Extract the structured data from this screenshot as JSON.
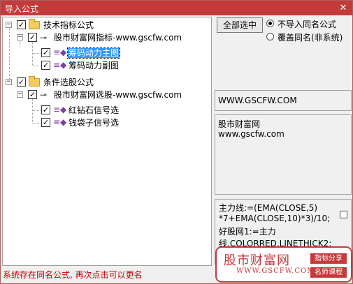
{
  "window": {
    "title": "导入公式",
    "close_glyph": "✕"
  },
  "tree": {
    "nodes": [
      {
        "label": "技术指标公式",
        "checked": true,
        "type": "folder"
      },
      {
        "label": "股市财富网指标-www.gscfw.com",
        "checked": true,
        "type": "group"
      },
      {
        "label": "筹码动力主图",
        "checked": true,
        "type": "formula",
        "selected": true
      },
      {
        "label": "筹码动力副图",
        "checked": true,
        "type": "formula"
      },
      {
        "label": "条件选股公式",
        "checked": true,
        "type": "folder"
      },
      {
        "label": "股市财富网选股-www.gscfw.com",
        "checked": true,
        "type": "group"
      },
      {
        "label": "红钻石信号选",
        "checked": true,
        "type": "formula"
      },
      {
        "label": "钱袋子信号选",
        "checked": true,
        "type": "formula"
      }
    ],
    "expander_minus": "−",
    "check_glyph": "✓"
  },
  "options": {
    "select_all": "全部选中",
    "radio_skip": "不导入同名公式",
    "radio_overwrite": "覆盖同名(非系统)",
    "selected": "skip"
  },
  "info": {
    "url": "WWW.GSCFW.COM",
    "desc_line1": "股市财富网",
    "desc_line2": "www.gscfw.com"
  },
  "formula_preview": {
    "lines": [
      "主力线:=(EMA(CLOSE,5)",
      "*7+EMA(CLOSE,10)*3)/10;",
      "好股网1:=主力",
      "线,COLORRED,LINETHICK2;"
    ]
  },
  "status": "系统存在同名公式, 再次点击可以更名",
  "watermark": {
    "main": "股市财富网",
    "url": "WWW.GSCFW.COM",
    "tag1": "指标分享",
    "tag2": "名师课程"
  },
  "colors": {
    "accent": "#c33a3a",
    "status": "#c00000",
    "selection": "#3399ff"
  }
}
